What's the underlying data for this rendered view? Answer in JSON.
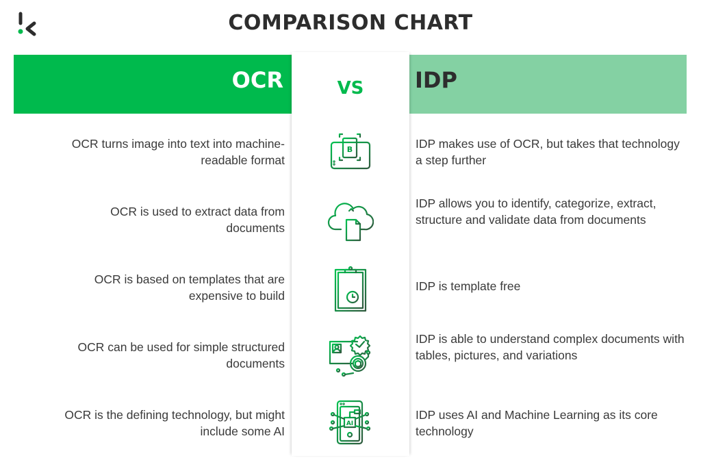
{
  "title": "COMPARISON CHART",
  "logo": {
    "icon": "k-logo-icon",
    "brand_colors": {
      "dark": "#2d2d2d",
      "accent": "#00ba4d"
    }
  },
  "header": {
    "left_label": "OCR",
    "vs_label": "VS",
    "right_label": "IDP"
  },
  "colors": {
    "left_band": "#00ba4d",
    "right_band": "#84d1a3",
    "vs_text": "#00ba4d",
    "body_text": "#3a3a3a"
  },
  "rows": [
    {
      "left": "OCR turns image into text into machine-readable format",
      "icon": "scan-document-icon",
      "right": "IDP makes use of OCR, but takes that technology a step further"
    },
    {
      "left": "OCR is used to extract data from documents",
      "icon": "cloud-document-upload-icon",
      "right": "IDP allows you to identify, categorize, extract, structure and validate data from documents"
    },
    {
      "left": "OCR is based on templates that are expensive to build",
      "icon": "clipboard-timer-icon",
      "right": "IDP is template free"
    },
    {
      "left": "OCR can be used for simple structured documents",
      "icon": "id-card-verified-icon",
      "right": "IDP is able to understand complex documents with tables, pictures, and variations"
    },
    {
      "left": "OCR is the defining technology, but might include some AI",
      "icon": "ai-chip-icon",
      "right": "IDP uses AI and Machine Learning as its core technology"
    }
  ]
}
